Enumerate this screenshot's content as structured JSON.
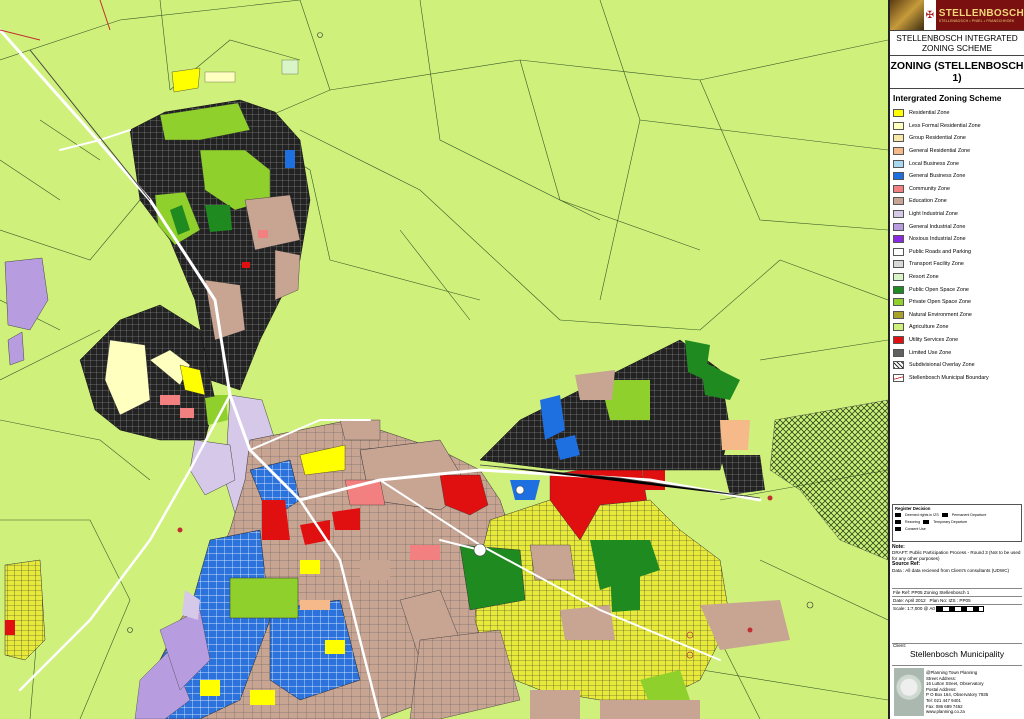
{
  "panel": {
    "brand": "STELLENBOSCH",
    "brand_sub": "STELLENBOSCH • PNIEL • FRANSCHHOEK",
    "title": "STELLENBOSCH INTEGRATED ZONING SCHEME",
    "zoning": "ZONING (STELLENBOSCH 1)",
    "legend_heading": "Intergrated Zoning Scheme",
    "legend": [
      {
        "label": "Residential Zone",
        "color": "#ffff00"
      },
      {
        "label": "Less Formal Residential Zone",
        "color": "#ffffc0"
      },
      {
        "label": "Group Residential Zone",
        "color": "#f9e7a8"
      },
      {
        "label": "General Residential Zone",
        "color": "#f5b98a"
      },
      {
        "label": "Local Business Zone",
        "color": "#a8d8f0"
      },
      {
        "label": "General Business Zone",
        "color": "#1e6fe0"
      },
      {
        "label": "Community Zone",
        "color": "#f28080"
      },
      {
        "label": "Education Zone",
        "color": "#c8a493"
      },
      {
        "label": "Light Industrial Zone",
        "color": "#d6c8e8"
      },
      {
        "label": "General Industrial Zone",
        "color": "#b89ce0"
      },
      {
        "label": "Noxious Industrial Zone",
        "color": "#8a2be2"
      },
      {
        "label": "Public Roads and Parking",
        "color": "#ffffff"
      },
      {
        "label": "Transport Facility Zone",
        "color": "#d8d8d8"
      },
      {
        "label": "Resort Zone",
        "color": "#d9f5c8"
      },
      {
        "label": "Public Open Space Zone",
        "color": "#1f8a1f"
      },
      {
        "label": "Private Open Space Zone",
        "color": "#8fd02c"
      },
      {
        "label": "Natural Environment Zone",
        "color": "#a8a22a"
      },
      {
        "label": "Agriculture Zone",
        "color": "#cff07a"
      },
      {
        "label": "Utility Services Zone",
        "color": "#e01010"
      },
      {
        "label": "Limited Use Zone",
        "color": "#606060"
      },
      {
        "label": "Subdivisional Overlay Zone",
        "color": "#9a9a9a"
      },
      {
        "label": "Stellenbosch Municipal Boundary",
        "color": "#ffffff"
      }
    ],
    "register_title": "Register Decision",
    "register_items": [
      "Deemed rights in IZS",
      "Permanent Departure",
      "Rezoning",
      "Temporary Departure",
      "Consent Use"
    ],
    "note_title": "Note:",
    "note_text": "DRAFT: Public Participation Process - Round 3 (Not to be used for any other purposes)",
    "source_title": "Source Ref:",
    "source_text": "Data : All data recieved from Client's consultants (UDWC)",
    "file_ref": "File Ref: PP05 Zoning Stellenbosch 1",
    "date_label": "Date:",
    "date_value": "April 2012",
    "plan_label": "Plan No:",
    "plan_value": "IZS : PP05",
    "scale_label": "Scale:",
    "scale_value": "1:7,000 @ A0",
    "client_label": "Client:",
    "client": "Stellenbosch Municipality",
    "firm_lines": [
      "@Planning Town Planning",
      "Street Address:",
      "16 Lutton Street, Observatory",
      "Postal Address:",
      "P O Box 164, Observatory 7935",
      "Tel: 021 447 9401",
      "Fax: 086 689 7462",
      "www.planning.co.za"
    ]
  }
}
